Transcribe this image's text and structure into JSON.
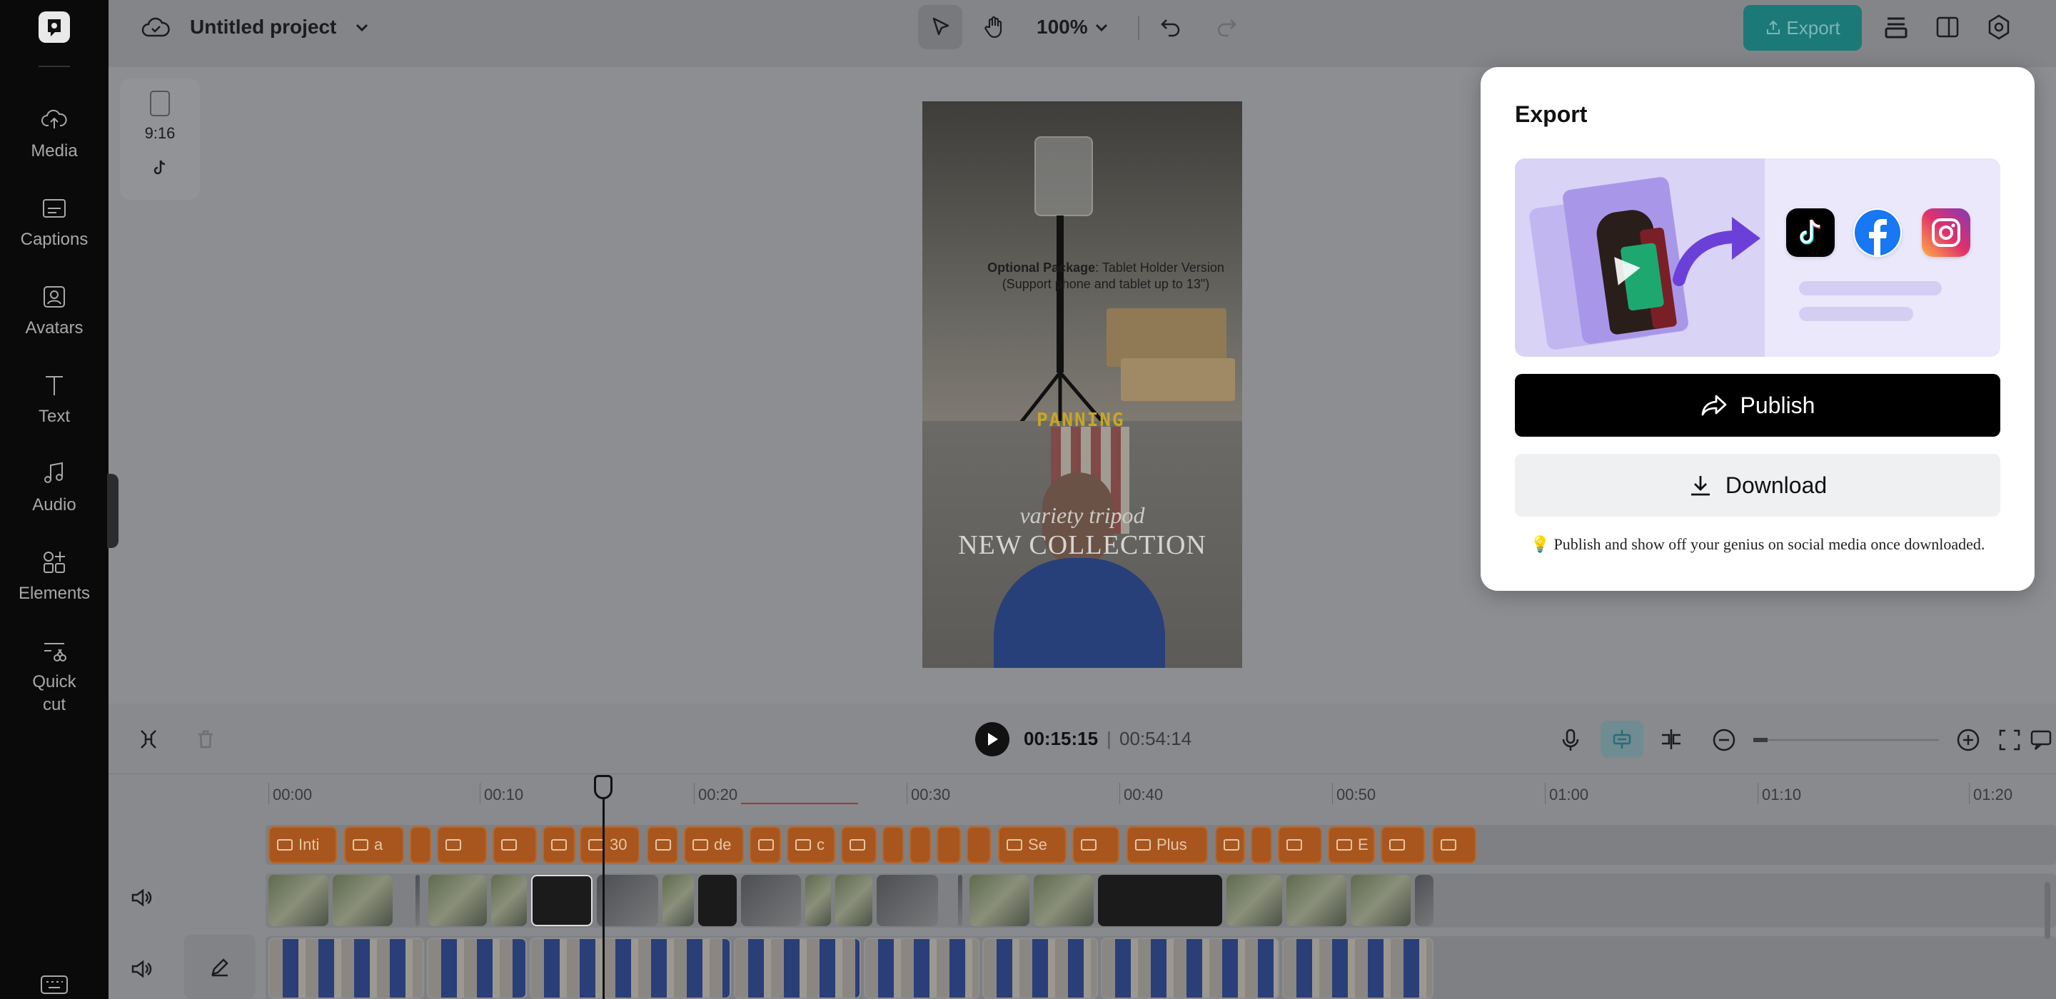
{
  "nav": {
    "items": [
      {
        "label": "Media",
        "icon": "cloud-upload-icon"
      },
      {
        "label": "Captions",
        "icon": "captions-icon"
      },
      {
        "label": "Avatars",
        "icon": "avatar-icon"
      },
      {
        "label": "Text",
        "icon": "text-icon"
      },
      {
        "label": "Audio",
        "icon": "music-note-icon"
      },
      {
        "label": "Elements",
        "icon": "elements-icon"
      },
      {
        "label": "Quick cut",
        "icon": "scissors-icon"
      }
    ]
  },
  "topbar": {
    "project_title": "Untitled project",
    "zoom": "100%",
    "export_label": "Export"
  },
  "canvas": {
    "aspect_ratio": "9:16",
    "preview_text": {
      "optional_bold": "Optional Package",
      "optional_rest": ": Tablet Holder Version",
      "support_line": "(Support phone and tablet up to 13\")",
      "panning": "PANNING",
      "variety": "variety tripod",
      "new_collection": "NEW COLLECTION"
    }
  },
  "timeline": {
    "current_time": "00:15:15",
    "separator": "|",
    "total_time": "00:54:14",
    "ruler": [
      "00:00",
      "00:10",
      "00:20",
      "00:30",
      "00:40",
      "00:50",
      "01:00",
      "01:10",
      "01:20"
    ],
    "text_chips": [
      "Inti",
      "a",
      "",
      "",
      "",
      "",
      "30",
      "",
      "de",
      "",
      "c",
      "",
      "",
      "",
      "",
      "",
      "Se",
      "",
      "Plus",
      "",
      "",
      "",
      "E",
      "",
      ""
    ]
  },
  "export_panel": {
    "title": "Export",
    "publish_label": "Publish",
    "download_label": "Download",
    "hint": "💡 Publish and show off your genius on social media once downloaded."
  },
  "colors": {
    "export_button": "#1b7a78",
    "chip": "#a8561d",
    "panel_bg": "#ffffff",
    "publish_bg": "#000000"
  }
}
